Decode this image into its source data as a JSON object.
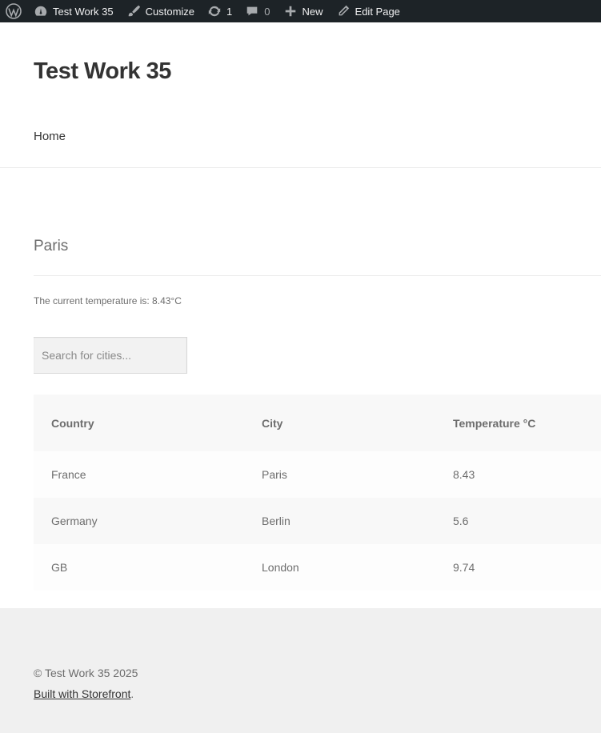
{
  "admin_bar": {
    "site_name": "Test Work 35",
    "customize": "Customize",
    "updates_count": "1",
    "comments_count": "0",
    "new": "New",
    "edit_page": "Edit Page"
  },
  "header": {
    "site_title": "Test Work 35",
    "nav": [
      "Home"
    ]
  },
  "content": {
    "page_title": "Paris",
    "temperature_line": "The current temperature is: 8.43°C",
    "search_placeholder": "Search for cities..."
  },
  "table": {
    "columns": [
      "Country",
      "City",
      "Temperature °C"
    ],
    "rows": [
      [
        "France",
        "Paris",
        "8.43"
      ],
      [
        "Germany",
        "Berlin",
        "5.6"
      ],
      [
        "GB",
        "London",
        "9.74"
      ]
    ]
  },
  "footer": {
    "copyright": "© Test Work 35 2025",
    "credit_link": "Built with Storefront",
    "credit_suffix": "."
  },
  "icons": {
    "wordpress": "wordpress-logo-icon",
    "dashboard": "dashboard-icon",
    "customize": "brush-icon",
    "updates": "updates-icon",
    "comments": "comment-icon",
    "new": "plus-icon",
    "edit": "pencil-icon"
  }
}
